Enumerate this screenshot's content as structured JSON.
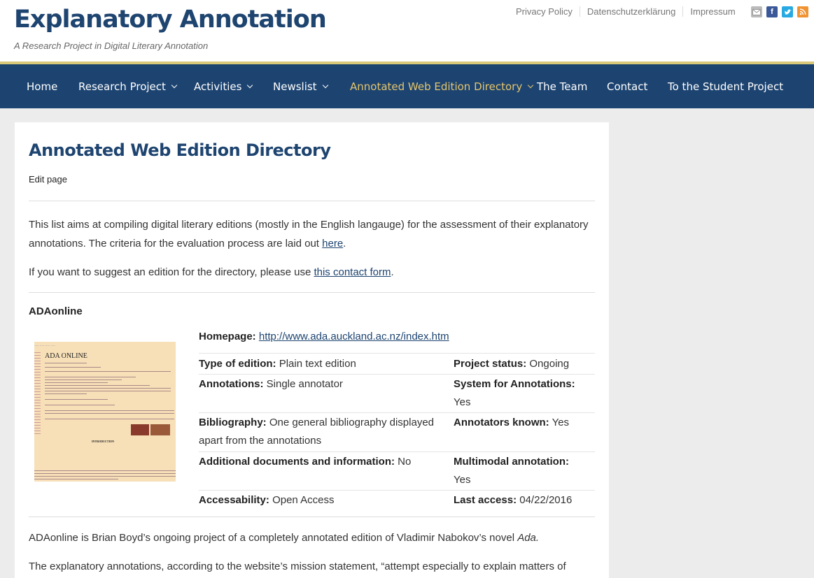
{
  "site": {
    "title": "Explanatory Annotation",
    "tagline": "A Research Project in Digital Literary Annotation"
  },
  "top_links": [
    "Privacy Policy",
    "Datenschutzerklärung",
    "Impressum"
  ],
  "social_icons": [
    "mail-icon",
    "facebook-icon",
    "twitter-icon",
    "rss-icon"
  ],
  "nav": {
    "items": [
      {
        "label": "Home"
      },
      {
        "label": "Research Project"
      },
      {
        "label": "Activities"
      },
      {
        "label": "Newslist"
      },
      {
        "label": "Annotated Web Edition Directory"
      },
      {
        "label": "The Team"
      },
      {
        "label": "Contact"
      },
      {
        "label": "To the Student Project"
      }
    ],
    "active_color": "#e5c56b",
    "background": "#1d4471"
  },
  "page": {
    "title": "Annotated Web Edition Directory",
    "edit_label": "Edit page",
    "intro_1": "This list aims at compiling digital literary editions (mostly in the English langauge) for the assessment of their explanatory annotations. The criteria for the evaluation process are laid out ",
    "intro_1_link": "here",
    "intro_1_end": ".",
    "intro_2": "If you want to suggest an edition for the directory, please use ",
    "intro_2_link": "this contact form",
    "intro_2_end": "."
  },
  "entry": {
    "title": "ADAonline",
    "thumbnail": {
      "title": "ADA ONLINE",
      "section": "INTRODUCTION"
    },
    "homepage_label": "Homepage:",
    "homepage_url": "http://www.ada.auckland.ac.nz/index.htm",
    "fields": {
      "type_label": "Type of edition:",
      "type_value": "Plain text edition",
      "status_label": "Project status:",
      "status_value": "Ongoing",
      "annotations_label": "Annotations:",
      "annotations_value": "Single annotator",
      "system_label": "System for Annotations:",
      "system_value": "Yes",
      "bibliography_label": "Bibliography:",
      "bibliography_value_1": "One general bibliography displayed",
      "bibliography_value_2": "apart from the annotations",
      "annotators_label": "Annotators known:",
      "annotators_value": "Yes",
      "additional_label": "Additional documents and information:",
      "additional_value": "No",
      "multimodal_label": "Multimodal annotation:",
      "multimodal_value": "Yes",
      "access_label": "Accessability:",
      "access_value": "Open Access",
      "last_access_label": "Last access:",
      "last_access_value": "04/22/2016"
    },
    "description_1": "ADAonline is Brian Boyd’s ongoing project of a completely annotated edition of Vladimir Nabokov’s novel ",
    "description_1_italic": "Ada.",
    "description_2": "The explanatory annotations, according to the website’s mission statement, “attempt especially to explain matters of"
  }
}
